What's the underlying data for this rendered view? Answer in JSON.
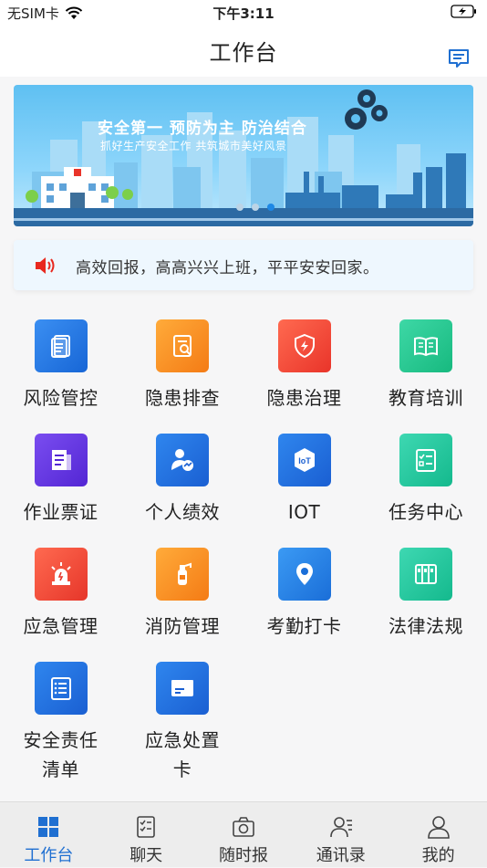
{
  "status_bar": {
    "carrier": "无SIM卡",
    "time": "下午3:11"
  },
  "header": {
    "title": "工作台",
    "message_icon": "message-icon"
  },
  "banner": {
    "title": "安全第一   预防为主   防治结合",
    "subtitle": "抓好生产安全工作   共筑城市美好风景",
    "slides": 3,
    "active_slide": 3
  },
  "notice": {
    "icon": "speaker-icon",
    "text": "高效回报，高高兴兴上班，平平安安回家。"
  },
  "grid": [
    {
      "label": "风险管控",
      "icon": "document-icon",
      "colors": [
        "#3b8ff2",
        "#1766d6"
      ]
    },
    {
      "label": "隐患排查",
      "icon": "search-document-icon",
      "colors": [
        "#ffab3a",
        "#f47b15"
      ]
    },
    {
      "label": "隐患治理",
      "icon": "shield-icon",
      "colors": [
        "#ff6a50",
        "#e9342a"
      ]
    },
    {
      "label": "教育培训",
      "icon": "book-icon",
      "colors": [
        "#3ed8a6",
        "#17b97f"
      ]
    },
    {
      "label": "作业票证",
      "icon": "ticket-icon",
      "colors": [
        "#7a4df0",
        "#5326d4"
      ]
    },
    {
      "label": "个人绩效",
      "icon": "person-chart-icon",
      "colors": [
        "#2f86ee",
        "#1a5fd2"
      ]
    },
    {
      "label": "IOT",
      "icon": "iot-icon",
      "colors": [
        "#2f86ee",
        "#1a5fd2"
      ]
    },
    {
      "label": "任务中心",
      "icon": "checklist-icon",
      "colors": [
        "#3ed8b2",
        "#14b98d"
      ]
    },
    {
      "label": "应急管理",
      "icon": "alarm-light-icon",
      "colors": [
        "#ff6a50",
        "#e6362a"
      ]
    },
    {
      "label": "消防管理",
      "icon": "fire-extinguisher-icon",
      "colors": [
        "#ffab3a",
        "#f47b15"
      ]
    },
    {
      "label": "考勤打卡",
      "icon": "location-pin-icon",
      "colors": [
        "#3b9af4",
        "#1a6ed8"
      ]
    },
    {
      "label": "法律法规",
      "icon": "binders-icon",
      "colors": [
        "#3ed8b2",
        "#14b98d"
      ]
    },
    {
      "label": "安全责任\n清单",
      "label_lines": [
        "安全责任",
        "清单"
      ],
      "icon": "list-icon",
      "colors": [
        "#2f86ee",
        "#1a5fd2"
      ]
    },
    {
      "label": "应急处置\n卡",
      "label_lines": [
        "应急处置",
        "卡"
      ],
      "icon": "card-icon",
      "colors": [
        "#2f86ee",
        "#1a5fd2"
      ]
    }
  ],
  "tabs": [
    {
      "label": "工作台",
      "icon": "grid-icon",
      "active": true
    },
    {
      "label": "聊天",
      "icon": "chat-list-icon",
      "active": false
    },
    {
      "label": "随时报",
      "icon": "camera-icon",
      "active": false
    },
    {
      "label": "通讯录",
      "icon": "contacts-icon",
      "active": false
    },
    {
      "label": "我的",
      "icon": "user-icon",
      "active": false
    }
  ],
  "colors": {
    "accent": "#1f6fd1",
    "tab_bar": "#ededed",
    "notice_bg": "#eef7fe"
  }
}
